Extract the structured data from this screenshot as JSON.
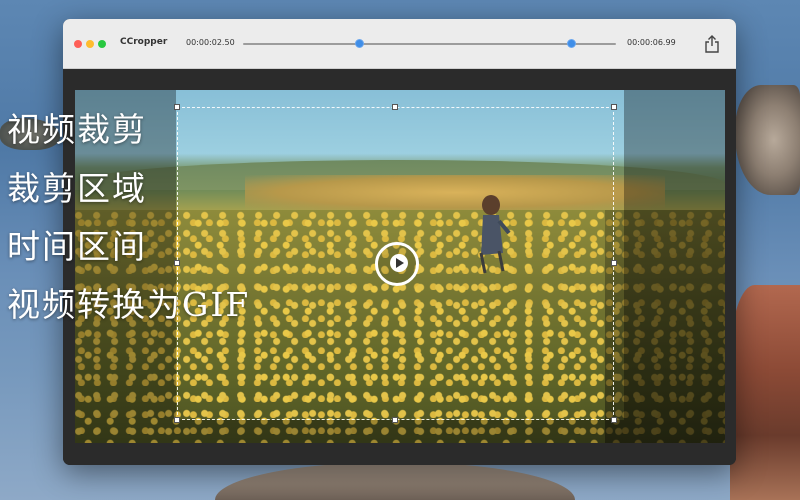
{
  "window": {
    "app_title": "CCropper",
    "start_time": "00:00:02.50",
    "end_time": "00:00:06.99",
    "trim_range": {
      "start_fraction": 0.31,
      "end_fraction": 0.88
    }
  },
  "captions": [
    "视频裁剪",
    "裁剪区域",
    "时间区间",
    "视频转换为GIF"
  ],
  "colors": {
    "accent": "#3f8ee8",
    "traffic_close": "#fe5f57",
    "traffic_min": "#febc2e",
    "traffic_max": "#28c840"
  },
  "icons": [
    "share-icon",
    "play-icon"
  ]
}
